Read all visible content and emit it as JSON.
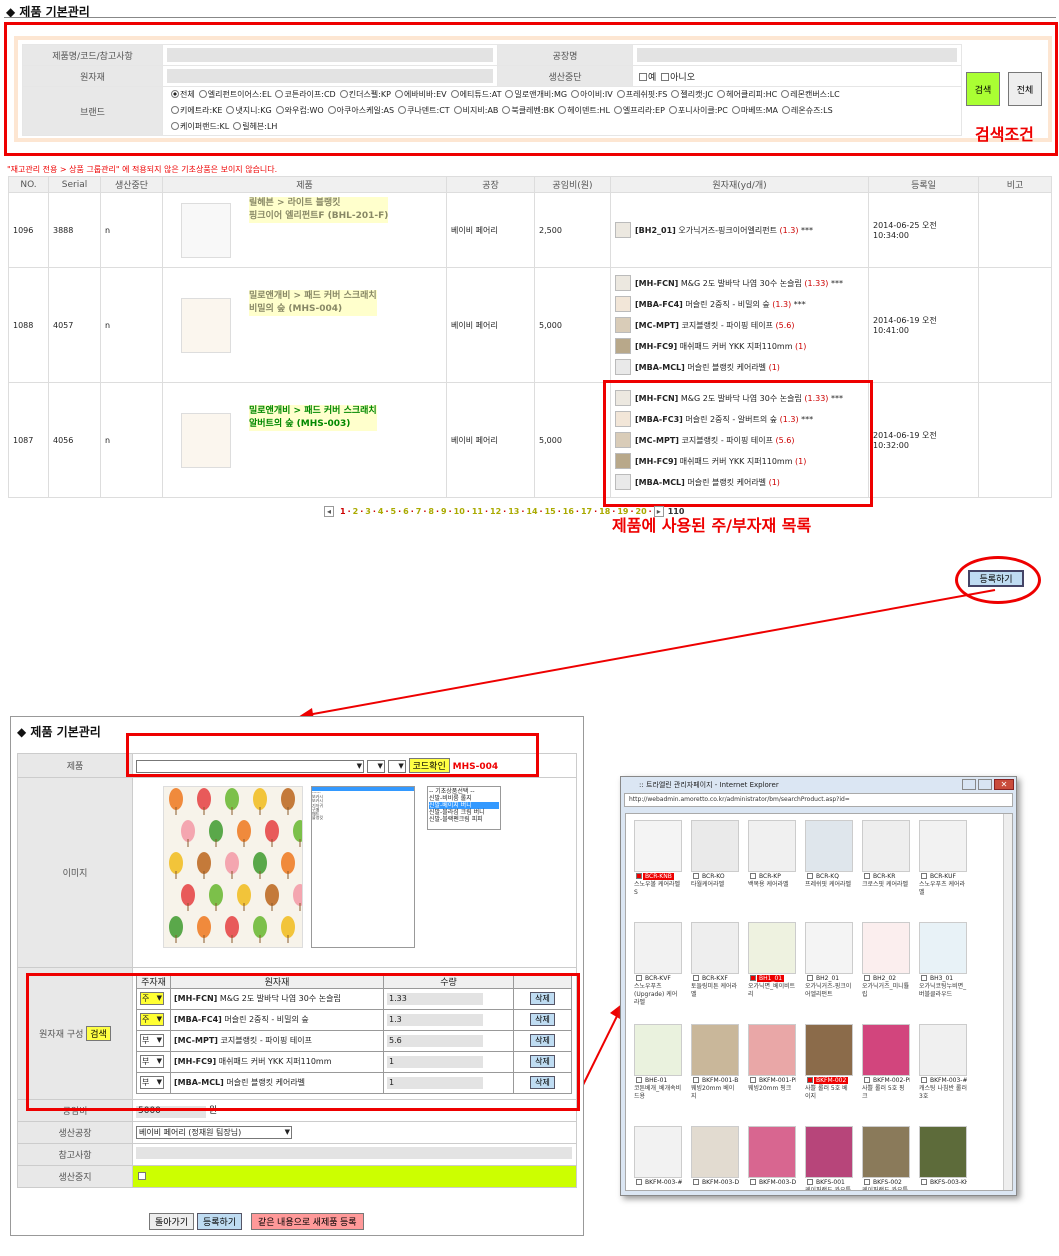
{
  "top": {
    "title": "◆ 제품 기본관리",
    "search": {
      "labels": {
        "product": "제품명/코드/참고사항",
        "factory": "공장명",
        "material": "원자재",
        "discontinued": "생산중단",
        "brand": "브랜드"
      },
      "discontinued_options": [
        "예",
        "아니오"
      ],
      "brands_row1": [
        "전체",
        "엘리펀트이어스:EL",
        "코튼라이프:CD",
        "킨더스펠:KP",
        "에바비바:EV",
        "에티튜드:AT",
        "밀로앤개비:MG",
        "아이비:IV",
        "프레쉬핏:FS",
        "젤리캣:JC",
        "헤어클리피:HC",
        "레몬캔버스:LC"
      ],
      "brands_row2": [
        "키에트라:KE",
        "냇지니:KG",
        "와우컵:WO",
        "아쿠아스케일:AS",
        "쿠나덴트:CT",
        "비지비:AB",
        "북클레벤:BK",
        "헤이덴트:HL",
        "엘프리라:EP",
        "포니사이클:PC",
        "마베뜨:MA",
        "레온슈즈:LS"
      ],
      "brands_row3": [
        "케이퍼랜드:KL",
        "릴헤븐:LH"
      ],
      "search_btn": "검색",
      "all_btn": "전체",
      "annotation": "검색조건"
    },
    "notice": "\"재고관리 전용 > 상품 그룹관리\" 에 적용되지 않은 기초상품은 보이지 않습니다.",
    "table": {
      "headers": [
        "NO.",
        "Serial",
        "생산중단",
        "제품",
        "공장",
        "공임비(원)",
        "원자재(yd/개)",
        "등록일",
        "비고"
      ],
      "rows": [
        {
          "no": "1096",
          "serial": "3888",
          "stop": "n",
          "name1": "릴헤븐 > 라이트 블랭킷",
          "name2": "핑크이어 엘리펀트F (BHL-201-F)",
          "factory": "베이비 페어리",
          "cost": "2,500",
          "date": "2014-06-25 오전 10:34:00",
          "mats": [
            {
              "code": "[BH2_01]",
              "desc": "오가닉거즈-핑크이어엘리펀트",
              "qty": "(1.3)",
              "extra": " ***"
            }
          ]
        },
        {
          "no": "1088",
          "serial": "4057",
          "stop": "n",
          "name1": "밀로앤개비 > 패드 커버 스크래치",
          "name2": "비밀의 숲 (MHS-004)",
          "factory": "베이비 페어리",
          "cost": "5,000",
          "date": "2014-06-19 오전 10:41:00",
          "mats": [
            {
              "code": "[MH-FCN]",
              "desc": "M&G 2도 발바닥 나염 30수 논슬립",
              "qty": "(1.33)",
              "extra": " ***"
            },
            {
              "code": "[MBA-FC4]",
              "desc": "머슬린 2중직 - 비밀의 숲",
              "qty": "(1.3)",
              "extra": " ***"
            },
            {
              "code": "[MC-MPT]",
              "desc": "코지블랭킷 - 파이핑 테이프",
              "qty": "(5.6)",
              "extra": ""
            },
            {
              "code": "[MH-FC9]",
              "desc": "매쉬패드 커버 YKK 지퍼110mm",
              "qty": "(1)",
              "extra": ""
            },
            {
              "code": "[MBA-MCL]",
              "desc": "머슬린 블랭킷 케어라벨",
              "qty": "(1)",
              "extra": ""
            }
          ]
        },
        {
          "no": "1087",
          "serial": "4056",
          "stop": "n",
          "name1": "밀로앤개비 > 패드 커버 스크래치",
          "name2": "알버트의 숲 (MHS-003)",
          "factory": "베이비 페어리",
          "cost": "5,000",
          "date": "2014-06-19 오전 10:32:00",
          "mats": [
            {
              "code": "[MH-FCN]",
              "desc": "M&G 2도 발바닥 나염 30수 논슬립",
              "qty": "(1.33)",
              "extra": " ***"
            },
            {
              "code": "[MBA-FC3]",
              "desc": "머슬린 2중직 - 알버트의 숲",
              "qty": "(1.3)",
              "extra": " ***"
            },
            {
              "code": "[MC-MPT]",
              "desc": "코지블랭킷 - 파이핑 테이프",
              "qty": "(5.6)",
              "extra": ""
            },
            {
              "code": "[MH-FC9]",
              "desc": "매쉬패드 커버 YKK 지퍼110mm",
              "qty": "(1)",
              "extra": ""
            },
            {
              "code": "[MBA-MCL]",
              "desc": "머슬린 블랭킷 케어라벨",
              "qty": "(1)",
              "extra": ""
            }
          ]
        }
      ]
    },
    "pages": [
      "1",
      "2",
      "3",
      "4",
      "5",
      "6",
      "7",
      "8",
      "9",
      "10",
      "11",
      "12",
      "13",
      "14",
      "15",
      "16",
      "17",
      "18",
      "19",
      "20"
    ],
    "page_end": "110",
    "material_annotation": "제품에 사용된 주/부자재 목록",
    "register_btn": "등록하기"
  },
  "form": {
    "title": "◆ 제품 기본관리",
    "labels": {
      "product": "제품",
      "image": "이미지",
      "material": "원자재 구성",
      "cost": "공임비",
      "factory": "생산공장",
      "note": "참고사항",
      "stop": "생산중지"
    },
    "code_btn": "코드확인",
    "code_value": "MHS-004",
    "search_btn": "검색",
    "list1": [
      "------",
      "보카시",
      "보카시",
      "",
      "기저귀",
      "",
      "구매",
      "매트",
      "",
      "",
      "블랭킷",
      "",
      "",
      "",
      "",
      "",
      "",
      "",
      "",
      "",
      "",
      "",
      "",
      "",
      "",
      "",
      "",
      "",
      "",
      "",
      "",
      "",
      "",
      "",
      "",
      "",
      "",
      "",
      ""
    ],
    "list2": [
      "-- 기초상품선택 --",
      "신발-비비룸 롤지",
      "신발-베이지 버니",
      "신발-블라섬 크림 버니",
      "신발-블랙펜크림 피피"
    ],
    "mat_headers": [
      "주자재",
      "원자재",
      "수량",
      ""
    ],
    "mat_rows": [
      {
        "type": "주",
        "code": "[MH-FCN]",
        "desc": "M&G 2도 발바닥 나염 30수 논슬립",
        "qty": "1.33",
        "del": "삭제"
      },
      {
        "type": "주",
        "code": "[MBA-FC4]",
        "desc": "머슬린 2중직 - 비밀의 숲",
        "qty": "1.3",
        "del": "삭제"
      },
      {
        "type": "부",
        "code": "[MC-MPT]",
        "desc": "코지블랭킷 - 파이핑 테이프",
        "qty": "5.6",
        "del": "삭제"
      },
      {
        "type": "부",
        "code": "[MH-FC9]",
        "desc": "매쉬패드 커버 YKK 지퍼110mm",
        "qty": "1",
        "del": "삭제"
      },
      {
        "type": "부",
        "code": "[MBA-MCL]",
        "desc": "머슬린 블랭킷 케어라벨",
        "qty": "1",
        "del": "삭제"
      }
    ],
    "cost_value": "5000",
    "cost_unit": "원",
    "factory_value": "베이비 페어리 (정재원 팀장님)",
    "btn_back": "돌아가기",
    "btn_register": "등록하기",
    "btn_new": "같은 내용으로 새제품 등록"
  },
  "popup": {
    "title": ":: 트라엘린 관리자페이지 - Internet Explorer",
    "url": "http://webadmin.amoretto.co.kr/administrator/bm/searchProduct.asp?id=",
    "items": [
      {
        "code": "BCR-KNB",
        "name": "스노우볼 케어라벨 S",
        "sel": true,
        "color": "#f4f4f4"
      },
      {
        "code": "BCR-KO",
        "name": "타월케어라벨",
        "sel": false,
        "color": "#eaeaea"
      },
      {
        "code": "BCR-KP",
        "name": "백목용 케어라벨",
        "sel": false,
        "color": "#f0f0f0"
      },
      {
        "code": "BCR-KQ",
        "name": "프레쉬핏 케어라벨",
        "sel": false,
        "color": "#dfe6ec"
      },
      {
        "code": "BCR-KR",
        "name": "크로스핏 케어라벨",
        "sel": false,
        "color": "#eeeeee"
      },
      {
        "code": "BCR-KUF",
        "name": "스노우푸츠 케어라벨",
        "sel": false,
        "color": "#f2f2f2"
      },
      {
        "code": "BCR-KVF",
        "name": "스노우푸츠(Upgrade) 케어라벨",
        "sel": false,
        "color": "#f2f2f2"
      },
      {
        "code": "BCR-KXF",
        "name": "토들링미튼 케어라벨",
        "sel": false,
        "color": "#eeeeee"
      },
      {
        "code": "BH1_01",
        "name": "오가닉면_베이비트리",
        "sel": true,
        "color": "#eef2e0"
      },
      {
        "code": "BH2_01",
        "name": "오가닉거즈-핑크이어엘리펀트",
        "sel": false,
        "color": "#f4f4f4"
      },
      {
        "code": "BH2_02",
        "name": "오가닉거즈_미니튤립",
        "sel": false,
        "color": "#fbeeee"
      },
      {
        "code": "BH3_01",
        "name": "오가닉코팅누비면_버블클라우드",
        "sel": false,
        "color": "#e8f2f7"
      },
      {
        "code": "BHE-01",
        "name": "코튼베개_베개속비드용",
        "sel": false,
        "color": "#eaf2de"
      },
      {
        "code": "BKFM-001-BE",
        "name": "웨빙20mm 베이지",
        "sel": false,
        "color": "#c9b79a"
      },
      {
        "code": "BKFM-001-PK",
        "name": "웨빙20mm 핑크",
        "sel": false,
        "color": "#e9a7a7"
      },
      {
        "code": "BKFM-002",
        "name": "사쁠 롤러 5호 베이지",
        "sel": true,
        "color": "#8b6b4a"
      },
      {
        "code": "BKFM-002-PK",
        "name": "사쁠 롤러 5호 핑크",
        "sel": false,
        "color": "#d2457d"
      },
      {
        "code": "BKFM-003-#3",
        "name": "캐스팅 나침반 롤러 3호",
        "sel": false,
        "color": "#f0f0f0"
      },
      {
        "code": "BKFM-003-#5",
        "name": "",
        "sel": false,
        "color": "#f2f2f2"
      },
      {
        "code": "BKFM-003-D#5BE",
        "name": "",
        "sel": false,
        "color": "#e2dbd0"
      },
      {
        "code": "BKFM-003-D#5PK",
        "name": "",
        "sel": false,
        "color": "#d86690"
      },
      {
        "code": "BKFS-001",
        "name": "케이퍼랜드 카오틀",
        "sel": false,
        "color": "#b7457a"
      },
      {
        "code": "BKFS-002",
        "name": "케이퍼랜드 카오틀",
        "sel": false,
        "color": "#8a7a5a"
      },
      {
        "code": "BKFS-003-KH",
        "name": "",
        "sel": false,
        "color": "#5d6b3a"
      }
    ]
  }
}
